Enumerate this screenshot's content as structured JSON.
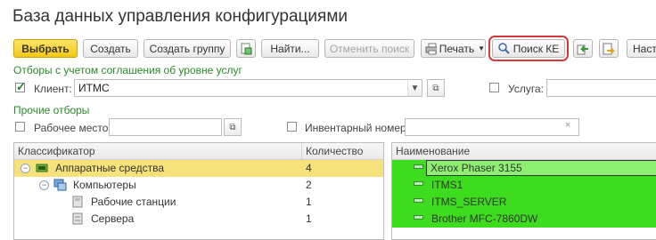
{
  "window": {
    "title": "База данных управления конфигурациями"
  },
  "toolbar": {
    "select": "Выбрать",
    "create": "Создать",
    "create_group": "Создать группу",
    "find": "Найти...",
    "cancel_search": "Отменить поиск",
    "print": "Печать",
    "search_ke": "Поиск КЕ",
    "settings_partial": "Наст"
  },
  "filters": {
    "sla_section": "Отборы с учетом соглашения об уровне услуг",
    "client_label": "Клиент:",
    "client_value": "ИТМС",
    "client_checked": true,
    "service_label": "Услуга:",
    "service_value": "",
    "other_section": "Прочие отборы",
    "workplace_label": "Рабочее место:",
    "workplace_value": "",
    "inventory_label": "Инвентарный номер:",
    "inventory_value": ""
  },
  "classifier_table": {
    "columns": [
      "Классификатор",
      "Количество"
    ],
    "rows": [
      {
        "name": "Аппаратные средства",
        "count": "4",
        "level": 0,
        "toggle": "−",
        "icon": "hardware-icon",
        "selected": true
      },
      {
        "name": "Компьютеры",
        "count": "2",
        "level": 1,
        "toggle": "−",
        "icon": "computers-icon",
        "selected": false
      },
      {
        "name": "Рабочие станции",
        "count": "1",
        "level": 2,
        "toggle": "",
        "icon": "workstation-icon",
        "selected": false
      },
      {
        "name": "Сервера",
        "count": "1",
        "level": 2,
        "toggle": "",
        "icon": "server-icon",
        "selected": false
      }
    ]
  },
  "items_table": {
    "columns": [
      "Наименование"
    ],
    "rows": [
      {
        "name": "Xerox Phaser 3155",
        "selected": true
      },
      {
        "name": "ITMS1",
        "selected": false
      },
      {
        "name": "ITMS_SERVER",
        "selected": false
      },
      {
        "name": "Brother MFC-7860DW",
        "selected": false
      }
    ]
  },
  "colors": {
    "accent_green": "#2a8a2a",
    "row_highlight": "#f5e27a",
    "item_green": "#3ddc1f",
    "item_selected": "#8ef070",
    "highlight_outline": "#d23a3a"
  }
}
